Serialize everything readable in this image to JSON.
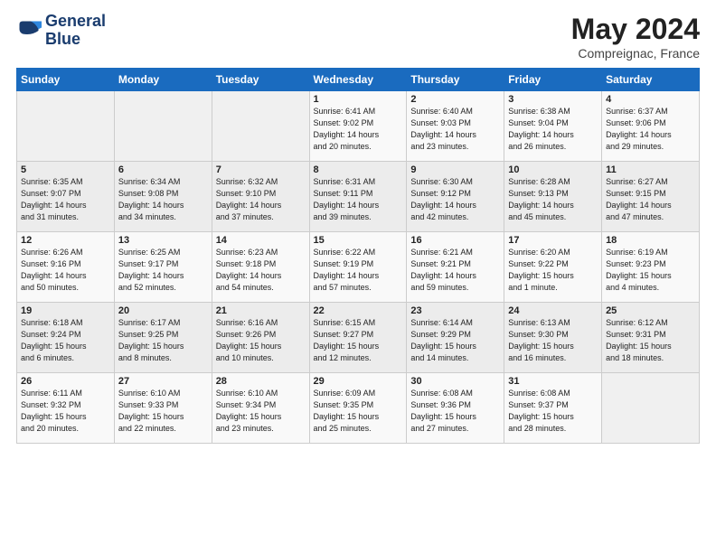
{
  "header": {
    "logo_line1": "General",
    "logo_line2": "Blue",
    "title": "May 2024",
    "subtitle": "Compreignac, France"
  },
  "weekdays": [
    "Sunday",
    "Monday",
    "Tuesday",
    "Wednesday",
    "Thursday",
    "Friday",
    "Saturday"
  ],
  "weeks": [
    [
      {
        "day": "",
        "info": ""
      },
      {
        "day": "",
        "info": ""
      },
      {
        "day": "",
        "info": ""
      },
      {
        "day": "1",
        "info": "Sunrise: 6:41 AM\nSunset: 9:02 PM\nDaylight: 14 hours\nand 20 minutes."
      },
      {
        "day": "2",
        "info": "Sunrise: 6:40 AM\nSunset: 9:03 PM\nDaylight: 14 hours\nand 23 minutes."
      },
      {
        "day": "3",
        "info": "Sunrise: 6:38 AM\nSunset: 9:04 PM\nDaylight: 14 hours\nand 26 minutes."
      },
      {
        "day": "4",
        "info": "Sunrise: 6:37 AM\nSunset: 9:06 PM\nDaylight: 14 hours\nand 29 minutes."
      }
    ],
    [
      {
        "day": "5",
        "info": "Sunrise: 6:35 AM\nSunset: 9:07 PM\nDaylight: 14 hours\nand 31 minutes."
      },
      {
        "day": "6",
        "info": "Sunrise: 6:34 AM\nSunset: 9:08 PM\nDaylight: 14 hours\nand 34 minutes."
      },
      {
        "day": "7",
        "info": "Sunrise: 6:32 AM\nSunset: 9:10 PM\nDaylight: 14 hours\nand 37 minutes."
      },
      {
        "day": "8",
        "info": "Sunrise: 6:31 AM\nSunset: 9:11 PM\nDaylight: 14 hours\nand 39 minutes."
      },
      {
        "day": "9",
        "info": "Sunrise: 6:30 AM\nSunset: 9:12 PM\nDaylight: 14 hours\nand 42 minutes."
      },
      {
        "day": "10",
        "info": "Sunrise: 6:28 AM\nSunset: 9:13 PM\nDaylight: 14 hours\nand 45 minutes."
      },
      {
        "day": "11",
        "info": "Sunrise: 6:27 AM\nSunset: 9:15 PM\nDaylight: 14 hours\nand 47 minutes."
      }
    ],
    [
      {
        "day": "12",
        "info": "Sunrise: 6:26 AM\nSunset: 9:16 PM\nDaylight: 14 hours\nand 50 minutes."
      },
      {
        "day": "13",
        "info": "Sunrise: 6:25 AM\nSunset: 9:17 PM\nDaylight: 14 hours\nand 52 minutes."
      },
      {
        "day": "14",
        "info": "Sunrise: 6:23 AM\nSunset: 9:18 PM\nDaylight: 14 hours\nand 54 minutes."
      },
      {
        "day": "15",
        "info": "Sunrise: 6:22 AM\nSunset: 9:19 PM\nDaylight: 14 hours\nand 57 minutes."
      },
      {
        "day": "16",
        "info": "Sunrise: 6:21 AM\nSunset: 9:21 PM\nDaylight: 14 hours\nand 59 minutes."
      },
      {
        "day": "17",
        "info": "Sunrise: 6:20 AM\nSunset: 9:22 PM\nDaylight: 15 hours\nand 1 minute."
      },
      {
        "day": "18",
        "info": "Sunrise: 6:19 AM\nSunset: 9:23 PM\nDaylight: 15 hours\nand 4 minutes."
      }
    ],
    [
      {
        "day": "19",
        "info": "Sunrise: 6:18 AM\nSunset: 9:24 PM\nDaylight: 15 hours\nand 6 minutes."
      },
      {
        "day": "20",
        "info": "Sunrise: 6:17 AM\nSunset: 9:25 PM\nDaylight: 15 hours\nand 8 minutes."
      },
      {
        "day": "21",
        "info": "Sunrise: 6:16 AM\nSunset: 9:26 PM\nDaylight: 15 hours\nand 10 minutes."
      },
      {
        "day": "22",
        "info": "Sunrise: 6:15 AM\nSunset: 9:27 PM\nDaylight: 15 hours\nand 12 minutes."
      },
      {
        "day": "23",
        "info": "Sunrise: 6:14 AM\nSunset: 9:29 PM\nDaylight: 15 hours\nand 14 minutes."
      },
      {
        "day": "24",
        "info": "Sunrise: 6:13 AM\nSunset: 9:30 PM\nDaylight: 15 hours\nand 16 minutes."
      },
      {
        "day": "25",
        "info": "Sunrise: 6:12 AM\nSunset: 9:31 PM\nDaylight: 15 hours\nand 18 minutes."
      }
    ],
    [
      {
        "day": "26",
        "info": "Sunrise: 6:11 AM\nSunset: 9:32 PM\nDaylight: 15 hours\nand 20 minutes."
      },
      {
        "day": "27",
        "info": "Sunrise: 6:10 AM\nSunset: 9:33 PM\nDaylight: 15 hours\nand 22 minutes."
      },
      {
        "day": "28",
        "info": "Sunrise: 6:10 AM\nSunset: 9:34 PM\nDaylight: 15 hours\nand 23 minutes."
      },
      {
        "day": "29",
        "info": "Sunrise: 6:09 AM\nSunset: 9:35 PM\nDaylight: 15 hours\nand 25 minutes."
      },
      {
        "day": "30",
        "info": "Sunrise: 6:08 AM\nSunset: 9:36 PM\nDaylight: 15 hours\nand 27 minutes."
      },
      {
        "day": "31",
        "info": "Sunrise: 6:08 AM\nSunset: 9:37 PM\nDaylight: 15 hours\nand 28 minutes."
      },
      {
        "day": "",
        "info": ""
      }
    ]
  ]
}
